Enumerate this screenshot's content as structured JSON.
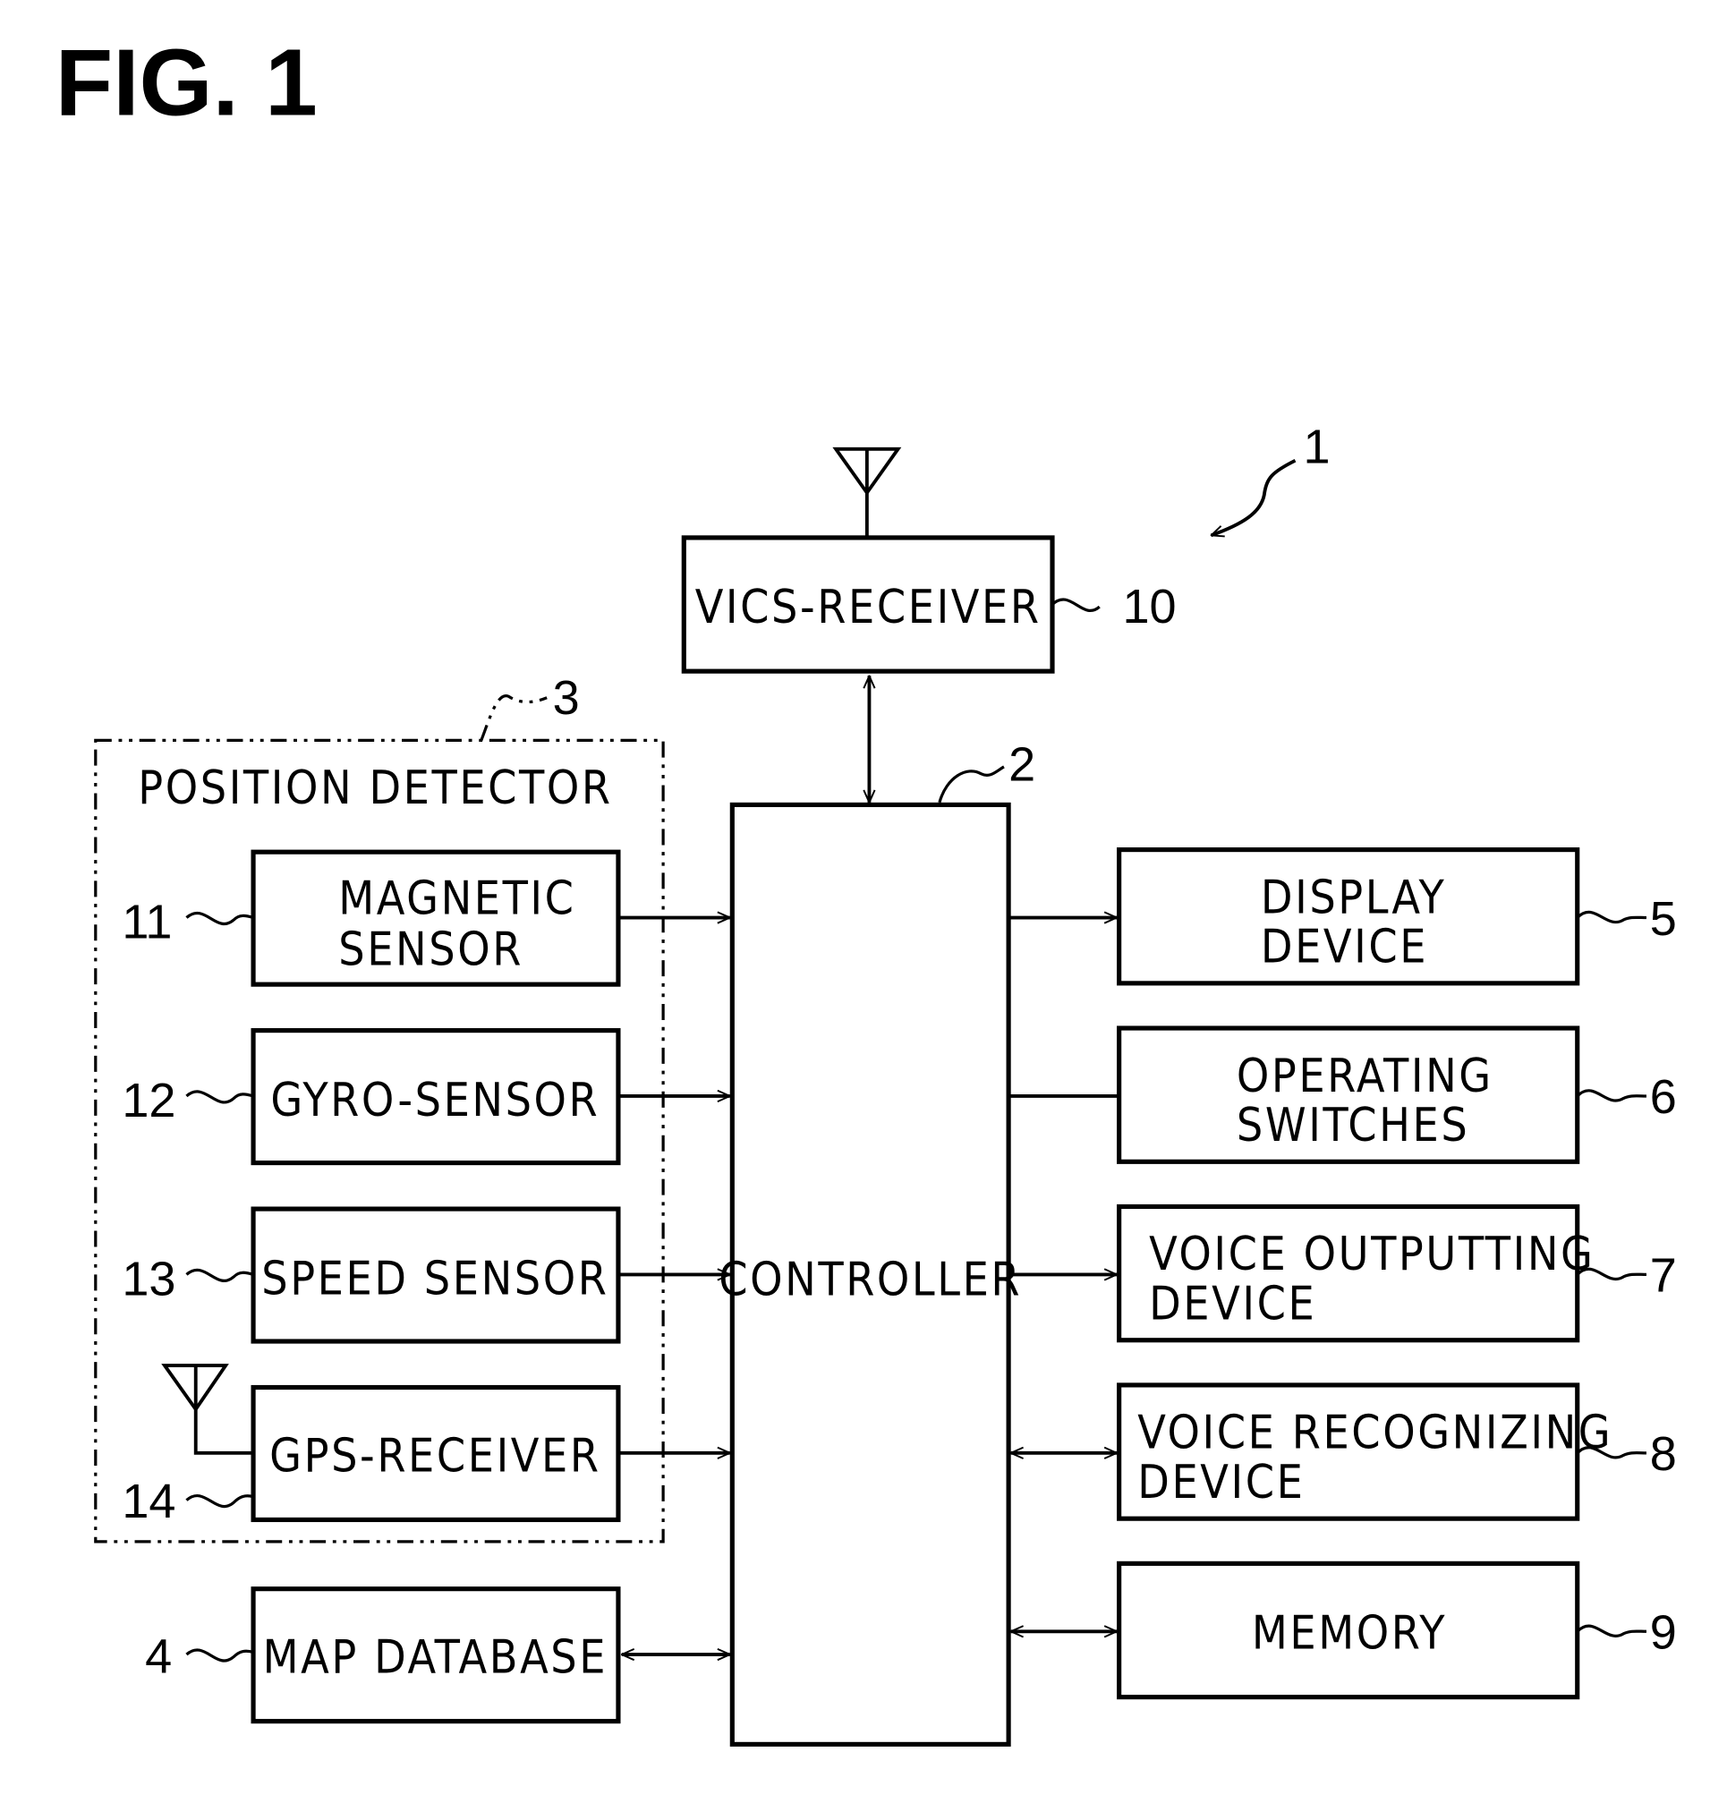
{
  "figure": {
    "title": "FIG. 1",
    "system_ref": "1"
  },
  "blocks": {
    "vics": {
      "lines": [
        "VICS-RECEIVER"
      ],
      "ref": "10"
    },
    "controller": {
      "lines": [
        "CONTROLLER"
      ],
      "ref": "2"
    },
    "position_detector": {
      "lines": [
        "POSITION DETECTOR"
      ],
      "ref": "3"
    },
    "magnetic": {
      "lines": [
        "MAGNETIC",
        "SENSOR"
      ],
      "ref": "11"
    },
    "gyro": {
      "lines": [
        "GYRO-SENSOR"
      ],
      "ref": "12"
    },
    "speed": {
      "lines": [
        "SPEED SENSOR"
      ],
      "ref": "13"
    },
    "gps": {
      "lines": [
        "GPS-RECEIVER"
      ],
      "ref": "14"
    },
    "map": {
      "lines": [
        "MAP DATABASE"
      ],
      "ref": "4"
    },
    "display": {
      "lines": [
        "DISPLAY",
        "DEVICE"
      ],
      "ref": "5"
    },
    "switches": {
      "lines": [
        "OPERATING",
        "SWITCHES"
      ],
      "ref": "6"
    },
    "voice_out": {
      "lines": [
        "VOICE OUTPUTTING",
        "DEVICE"
      ],
      "ref": "7"
    },
    "voice_rec": {
      "lines": [
        "VOICE RECOGNIZING",
        "DEVICE"
      ],
      "ref": "8"
    },
    "memory": {
      "lines": [
        "MEMORY"
      ],
      "ref": "9"
    }
  },
  "connections": [
    {
      "from": "vics",
      "to": "controller",
      "type": "bidirectional"
    },
    {
      "from": "magnetic",
      "to": "controller",
      "type": "arrow"
    },
    {
      "from": "gyro",
      "to": "controller",
      "type": "arrow"
    },
    {
      "from": "speed",
      "to": "controller",
      "type": "arrow"
    },
    {
      "from": "gps",
      "to": "controller",
      "type": "arrow"
    },
    {
      "from": "map",
      "to": "controller",
      "type": "bidirectional"
    },
    {
      "from": "controller",
      "to": "display",
      "type": "arrow"
    },
    {
      "from": "switches",
      "to": "controller",
      "type": "line"
    },
    {
      "from": "controller",
      "to": "voice_out",
      "type": "arrow"
    },
    {
      "from": "controller",
      "to": "voice_rec",
      "type": "bidirectional"
    },
    {
      "from": "controller",
      "to": "memory",
      "type": "bidirectional"
    }
  ]
}
